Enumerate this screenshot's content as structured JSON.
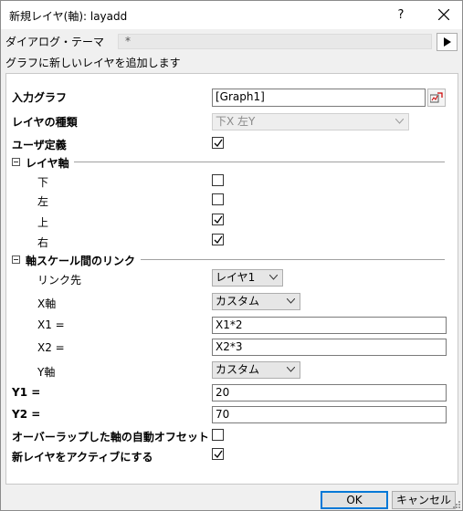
{
  "window": {
    "title": "新規レイヤ(軸): layadd",
    "help_label": "?"
  },
  "theme": {
    "label": "ダイアログ・テーマ",
    "value": "*"
  },
  "description": "グラフに新しいレイヤを追加します",
  "form": {
    "input_graph": {
      "label": "入力グラフ",
      "value": "[Graph1]"
    },
    "layer_type": {
      "label": "レイヤの種類",
      "value": "下X 左Y"
    },
    "user_defined": {
      "label": "ユーザ定義",
      "checked": true
    },
    "layer_axes": {
      "header": "レイヤ軸",
      "bottom": {
        "label": "下",
        "checked": false
      },
      "left": {
        "label": "左",
        "checked": false
      },
      "top": {
        "label": "上",
        "checked": true
      },
      "right": {
        "label": "右",
        "checked": true
      }
    },
    "axis_link": {
      "header": "軸スケール間のリンク",
      "link_to": {
        "label": "リンク先",
        "value": "レイヤ1"
      },
      "x_axis": {
        "label": "X軸",
        "value": "カスタム"
      },
      "x1": {
        "label": "X1 =",
        "value": "X1*2"
      },
      "x2": {
        "label": "X2 =",
        "value": "X2*3"
      },
      "y_axis": {
        "label": "Y軸",
        "value": "カスタム"
      }
    },
    "y1": {
      "label": "Y1 =",
      "value": "20"
    },
    "y2": {
      "label": "Y2 =",
      "value": "70"
    },
    "auto_offset": {
      "label": "オーバーラップした軸の自動オフセット",
      "checked": false
    },
    "activate_new": {
      "label": "新レイヤをアクティブにする",
      "checked": true
    }
  },
  "buttons": {
    "ok": "OK",
    "cancel": "キャンセル"
  }
}
